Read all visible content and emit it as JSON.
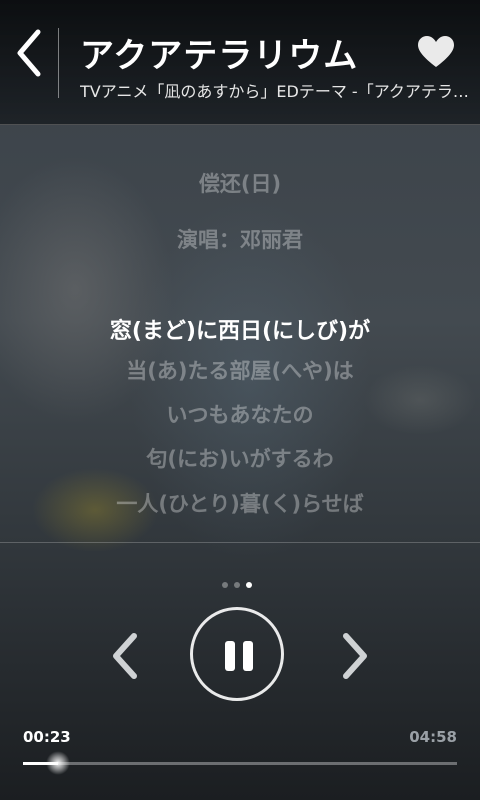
{
  "header": {
    "title": "アクアテラリウム",
    "subtitle": "TVアニメ「凪のあすから」EDテーマ -「アクアテラリウム」",
    "back_icon": "chevron-left-icon",
    "favorite_icon": "heart-icon"
  },
  "lyrics": {
    "lines": [
      "偿还(日)",
      "演唱：邓丽君",
      "窓(まど)に西日(にしび)が",
      "当(あ)たる部屋(へや)は",
      "いつもあなたの",
      "匂(にお)いがするわ",
      "一人(ひとり)暮(く)らせば"
    ],
    "current_index": 2
  },
  "pager": {
    "count": 3,
    "active": 2
  },
  "player": {
    "current_time": "00:23",
    "total_time": "04:58",
    "progress": 0.08,
    "prev_icon": "chevron-left-icon",
    "pause_icon": "pause-icon",
    "next_icon": "chevron-right-icon"
  }
}
